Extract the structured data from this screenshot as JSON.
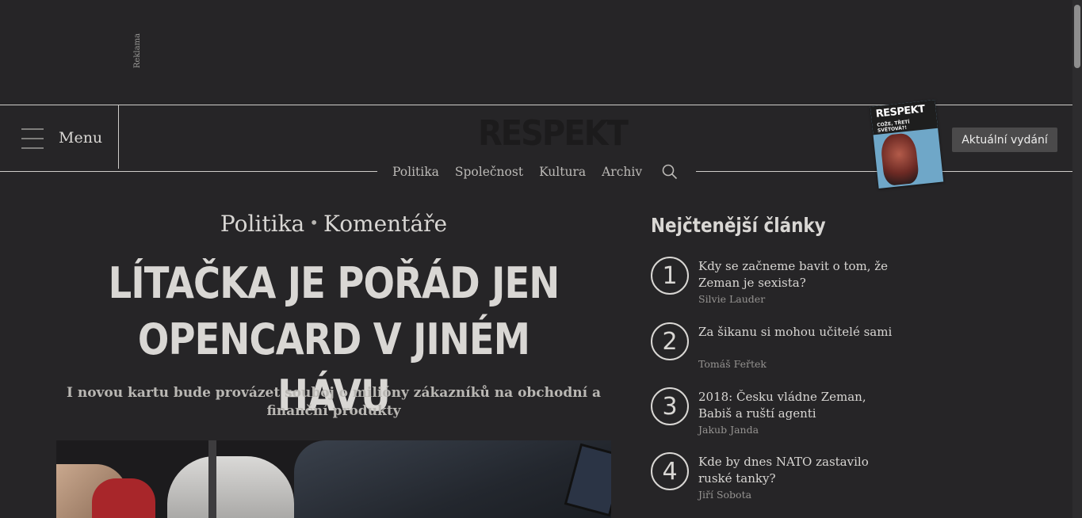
{
  "ad": {
    "label": "Reklama"
  },
  "header": {
    "menu_label": "Menu",
    "logo_text": "RESPEKT",
    "nav": [
      "Politika",
      "Společnost",
      "Kultura",
      "Archiv"
    ],
    "cover": {
      "name": "RESPEKT",
      "subtitle": "COŽE, TŘETÍ SVĚTOVÁ?!"
    },
    "issue_button": "Aktuální vydání"
  },
  "article": {
    "section": "Politika",
    "category": "Komentáře",
    "separator": "•",
    "title_line1": "LÍTAČKA JE POŘÁD JEN",
    "title_line2": "OPENCARD V JINÉM HÁVU",
    "perex": "I novou kartu bude provázet souboj o milióny zákazníků na obchodní a finanční produkty"
  },
  "sidebar": {
    "title": "Nejčtenější články",
    "items": [
      {
        "rank": "1",
        "title": "Kdy se začneme bavit o tom, že Zeman je sexista?",
        "author": "Silvie Lauder"
      },
      {
        "rank": "2",
        "title": "Za šikanu si mohou učitelé sami",
        "author": "Tomáš Feřtek"
      },
      {
        "rank": "3",
        "title": "2018: Česku vládne Zeman, Babiš a ruští agenti",
        "author": "Jakub Janda"
      },
      {
        "rank": "4",
        "title": "Kde by dnes NATO zastavilo ruské tanky?",
        "author": "Jiří Sobota"
      }
    ]
  }
}
